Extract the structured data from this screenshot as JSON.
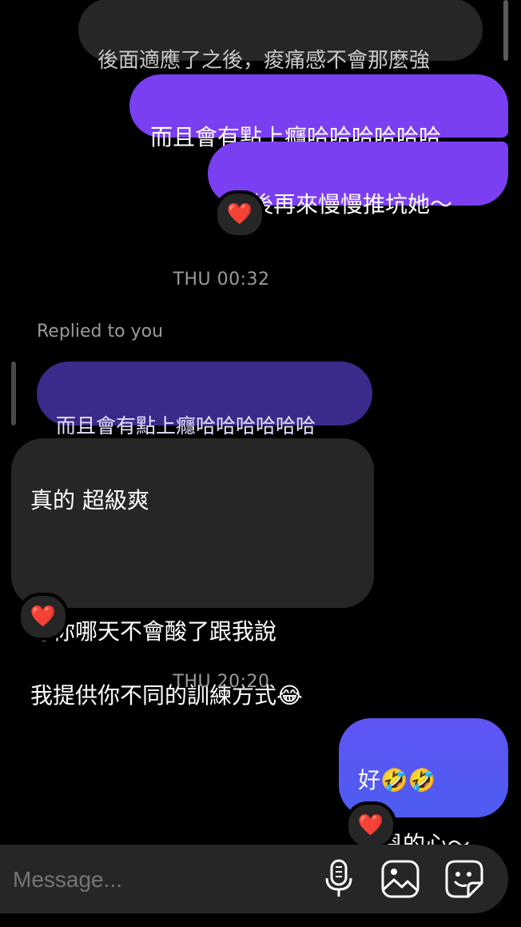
{
  "messages": {
    "m1": "後面適應了之後，痠痛感不會那麼強",
    "m2": "而且會有點上癮哈哈哈哈哈哈",
    "m3": "之後再來慢慢推坑她～",
    "m4_reply_label": "Replied to you",
    "m4_quoted": "而且會有點上癮哈哈哈哈哈哈",
    "m5_line1": "真的 超級爽",
    "m5_line2": "等你哪天不會酸了跟我說",
    "m5_line3": "我提供你不同的訓練方式😂",
    "m6_line1": "好🤣🤣",
    "m6_line2": "感恩的心～"
  },
  "timestamps": {
    "t1": "THU 00:32",
    "t2": "THU 20:20"
  },
  "reactions": {
    "heart": "❤️"
  },
  "composer": {
    "placeholder": "Message...",
    "mic_icon": "microphone-icon",
    "gallery_icon": "image-icon",
    "sticker_icon": "sticker-icon"
  },
  "colors": {
    "outgoing_purple": "#7b3ff2",
    "outgoing_blue": "#5a5af0",
    "quoted_reply": "#3b2a8a",
    "incoming": "#262626",
    "reaction_heart": "#e8243b"
  }
}
